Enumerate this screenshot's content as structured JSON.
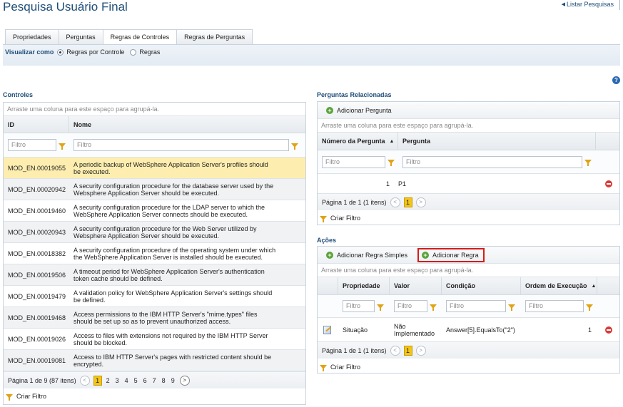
{
  "page": {
    "title": "Pesquisa Usuário Final",
    "list_link": "Listar Pesquisas"
  },
  "tabs": [
    "Propriedades",
    "Perguntas",
    "Regras de Controles",
    "Regras de Perguntas"
  ],
  "view": {
    "label": "Visualizar como",
    "opt1": "Regras por Controle",
    "opt2": "Regras",
    "selected": "Regras por Controle"
  },
  "help": "?",
  "controls": {
    "title": "Controles",
    "group_hint": "Arraste uma coluna para este espaço para agrupá-la.",
    "col_id": "ID",
    "col_name": "Nome",
    "filter_placeholder": "Filtro",
    "rows": [
      {
        "id": "MOD_EN.00019055",
        "name": "A periodic backup of WebSphere Application Server's profiles should be executed."
      },
      {
        "id": "MOD_EN.00020942",
        "name": "A security configuration procedure for the database server used by the Websphere Application Server should be executed."
      },
      {
        "id": "MOD_EN.00019460",
        "name": "A security configuration procedure for the LDAP server to which the WebSphere Application Server connects should be executed."
      },
      {
        "id": "MOD_EN.00020943",
        "name": "A security configuration procedure for the Web Server utilized by Websphere Application Server should be executed."
      },
      {
        "id": "MOD_EN.00018382",
        "name": "A security configuration procedure of the operating system under which the WebSphere Application Server is installed should be executed."
      },
      {
        "id": "MOD_EN.00019506",
        "name": "A timeout period for WebSphere Application Server's authentication token cache should be defined."
      },
      {
        "id": "MOD_EN.00019479",
        "name": "A validation policy for WebSphere Application Server's settings should be defined."
      },
      {
        "id": "MOD_EN.00019468",
        "name": "Access permissions to the IBM HTTP Server's \"mime.types\" files should be set up so as to prevent unauthorized access."
      },
      {
        "id": "MOD_EN.00019026",
        "name": "Access to files with extensions not required by the IBM HTTP Server should be blocked."
      },
      {
        "id": "MOD_EN.00019081",
        "name": "Access to IBM HTTP Server's pages with restricted content should be encrypted."
      }
    ],
    "pager_text": "Página 1 de 9 (87 itens)",
    "pages": [
      "1",
      "2",
      "3",
      "4",
      "5",
      "6",
      "7",
      "8",
      "9"
    ],
    "create_filter": "Criar Filtro"
  },
  "questions": {
    "title": "Perguntas Relacionadas",
    "add_button": "Adicionar Pergunta",
    "group_hint": "Arraste uma coluna para este espaço para agrupá-la.",
    "col_num": "Número da Pergunta",
    "col_q": "Pergunta",
    "filter_placeholder": "Filtro",
    "row": {
      "num": "1",
      "q": "P1"
    },
    "pager_text": "Página 1 de 1 (1 itens)",
    "page": "1",
    "create_filter": "Criar Filtro"
  },
  "actions": {
    "title": "Ações",
    "add_simple": "Adicionar Regra Simples",
    "add_rule": "Adicionar Regra",
    "group_hint": "Arraste uma coluna para este espaço para agrupá-la.",
    "col_prop": "Propriedade",
    "col_val": "Valor",
    "col_cond": "Condição",
    "col_order": "Ordem de Execução",
    "filter_placeholder": "Filtro",
    "row": {
      "prop": "Situação",
      "val": "Não Implementado",
      "cond": "Answer[5].EqualsTo(\"2\")",
      "order": "1"
    },
    "pager_text": "Página 1 de 1 (1 itens)",
    "page": "1",
    "create_filter": "Criar Filtro"
  },
  "colors": {
    "title": "#1f4e79",
    "selected_row": "#fdeeb0",
    "highlight_box": "#d61a1a",
    "add_green": "#5aa23a",
    "remove_red": "#d93a3a"
  }
}
